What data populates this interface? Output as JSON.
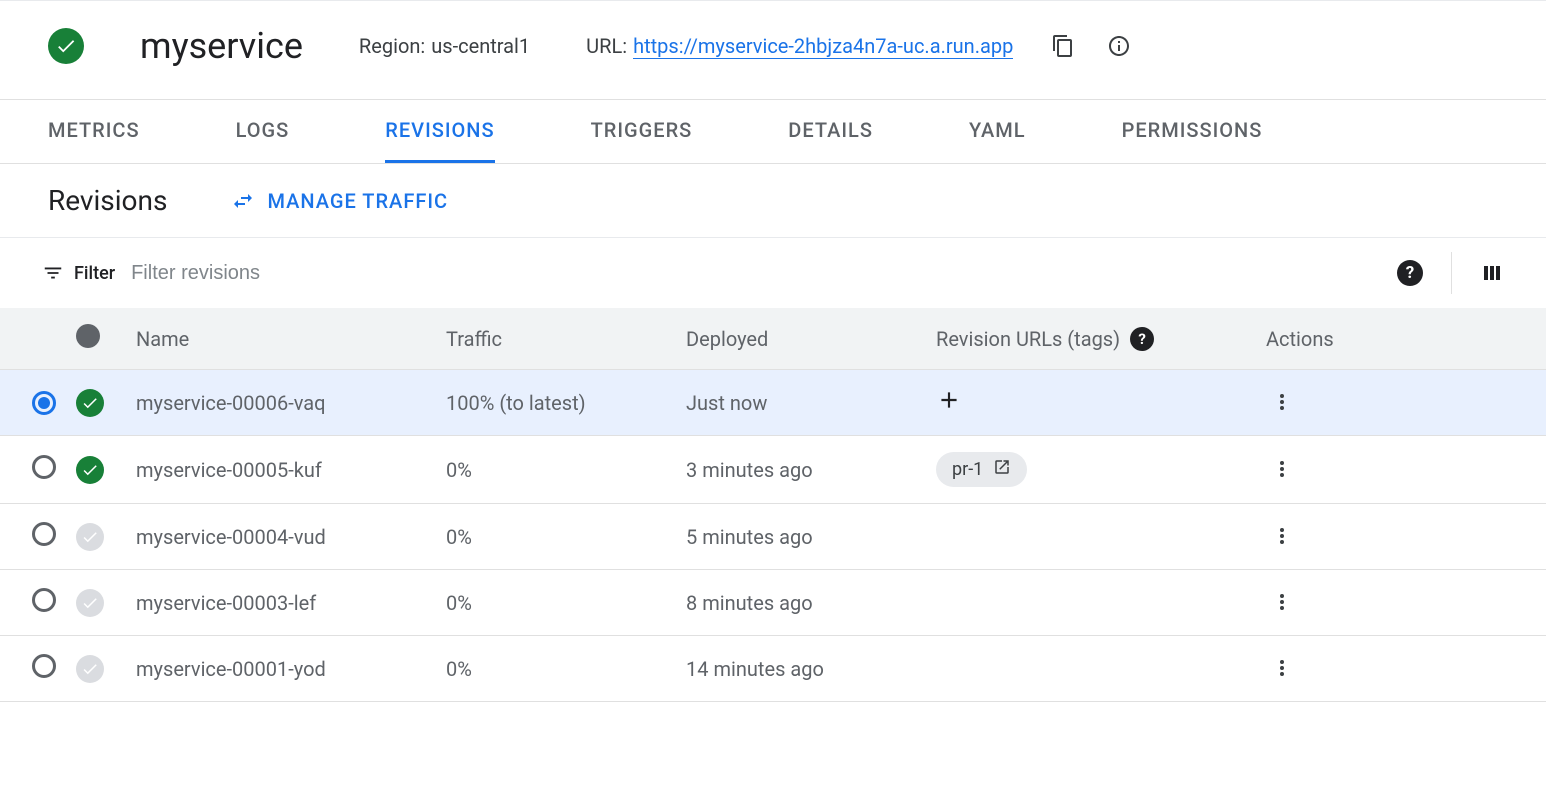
{
  "header": {
    "service_name": "myservice",
    "region_label": "Region:",
    "region_value": "us-central1",
    "url_label": "URL:",
    "url_value": "https://myservice-2hbjza4n7a-uc.a.run.app"
  },
  "tabs": [
    {
      "label": "METRICS",
      "active": false
    },
    {
      "label": "LOGS",
      "active": false
    },
    {
      "label": "REVISIONS",
      "active": true
    },
    {
      "label": "TRIGGERS",
      "active": false
    },
    {
      "label": "DETAILS",
      "active": false
    },
    {
      "label": "YAML",
      "active": false
    },
    {
      "label": "PERMISSIONS",
      "active": false
    }
  ],
  "subheader": {
    "title": "Revisions",
    "manage_traffic_label": "MANAGE TRAFFIC"
  },
  "filter": {
    "label": "Filter",
    "placeholder": "Filter revisions"
  },
  "columns": {
    "name": "Name",
    "traffic": "Traffic",
    "deployed": "Deployed",
    "urls": "Revision URLs (tags)",
    "actions": "Actions"
  },
  "rows": [
    {
      "selected": true,
      "status": "green",
      "name": "myservice-00006-vaq",
      "traffic": "100% (to latest)",
      "deployed": "Just now",
      "tag": null,
      "show_add": true
    },
    {
      "selected": false,
      "status": "green",
      "name": "myservice-00005-kuf",
      "traffic": "0%",
      "deployed": "3 minutes ago",
      "tag": "pr-1",
      "show_add": false
    },
    {
      "selected": false,
      "status": "grey",
      "name": "myservice-00004-vud",
      "traffic": "0%",
      "deployed": "5 minutes ago",
      "tag": null,
      "show_add": false
    },
    {
      "selected": false,
      "status": "grey",
      "name": "myservice-00003-lef",
      "traffic": "0%",
      "deployed": "8 minutes ago",
      "tag": null,
      "show_add": false
    },
    {
      "selected": false,
      "status": "grey",
      "name": "myservice-00001-yod",
      "traffic": "0%",
      "deployed": "14 minutes ago",
      "tag": null,
      "show_add": false
    }
  ]
}
